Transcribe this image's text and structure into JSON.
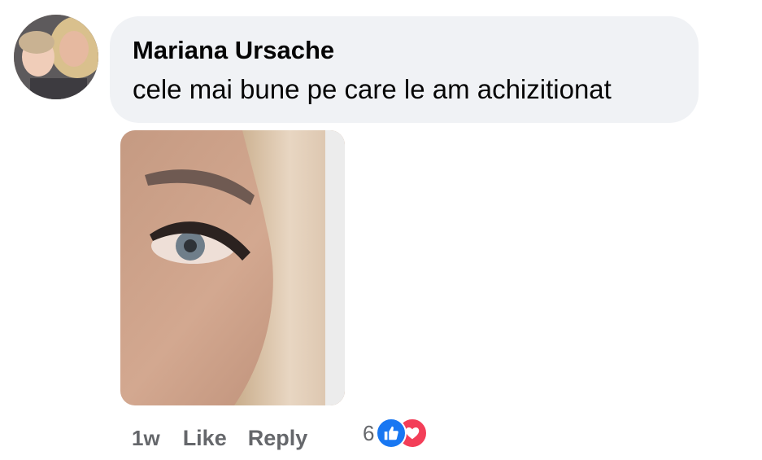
{
  "comment": {
    "author": "Mariana Ursache",
    "text": "cele mai bune pe care le am achizitionat",
    "avatar_icon": "user-avatar",
    "photo_icon": "attached-photo-eye"
  },
  "actions": {
    "time": "1w",
    "like_label": "Like",
    "reply_label": "Reply"
  },
  "reactions": {
    "count": "6",
    "types": [
      "like",
      "love"
    ],
    "colors": {
      "like": "#1877f2",
      "love": "#f33e58"
    }
  }
}
